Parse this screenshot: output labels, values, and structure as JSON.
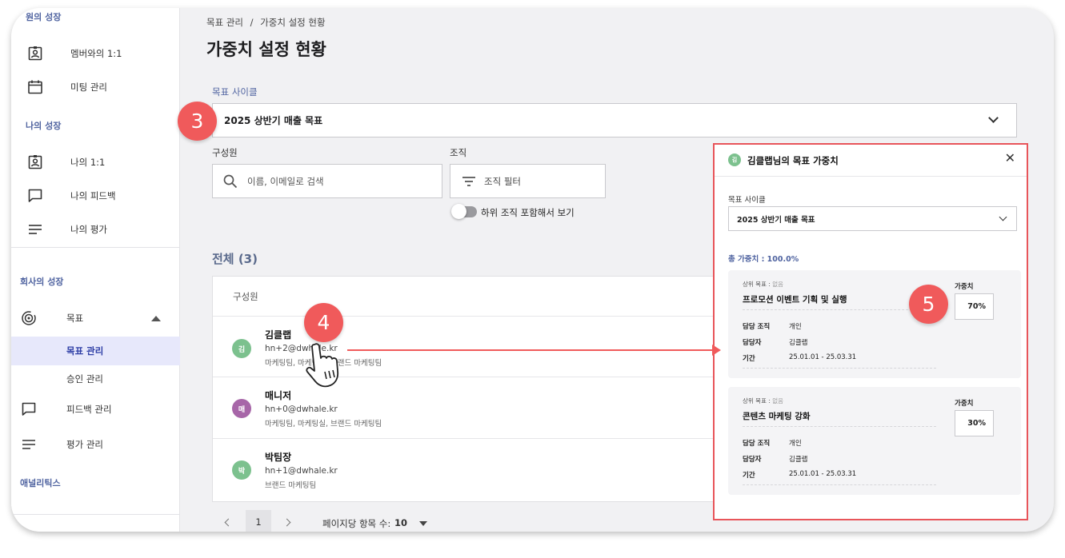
{
  "sidebar": {
    "team_growth_header": "원의 성장",
    "team_items": [
      {
        "label": "멤버와의 1:1",
        "icon": "portrait-badge-icon"
      },
      {
        "label": "미팅 관리",
        "icon": "calendar-icon"
      }
    ],
    "my_growth_header": "나의 성장",
    "my_items": [
      {
        "label": "나의 1:1",
        "icon": "portrait-badge-icon"
      },
      {
        "label": "나의 피드백",
        "icon": "chat-bubble-icon"
      },
      {
        "label": "나의 평가",
        "icon": "lines-icon"
      }
    ],
    "company_growth_header": "회사의 성장",
    "goal": {
      "label": "목표",
      "icon": "target-icon"
    },
    "goal_sub": [
      {
        "label": "목표 관리",
        "active": true
      },
      {
        "label": "승인 관리",
        "active": false
      }
    ],
    "feedback_mgmt": {
      "label": "피드백 관리",
      "icon": "chat-bubble-icon"
    },
    "review_mgmt": {
      "label": "평가 관리",
      "icon": "lines-icon"
    },
    "analytics_header": "애널리틱스"
  },
  "breadcrumb": {
    "parent": "목표 관리",
    "separator": "/",
    "current": "가중치 설정 현황"
  },
  "page_title": "가중치 설정 현황",
  "goal_cycle": {
    "label": "목표 사이클",
    "value": "2025 상반기 매출 목표"
  },
  "member_filter": {
    "label": "구성원",
    "placeholder": "이름, 이메일로 검색"
  },
  "org_filter": {
    "label": "조직",
    "value": "조직 필터"
  },
  "include_sub_org": {
    "label": "하위 조직 포함해서 보기",
    "enabled": false
  },
  "total_label": "전체 (3)",
  "table": {
    "column_header": "구성원",
    "rows": [
      {
        "initial": "김",
        "name": "김클랩",
        "email": "hn+2@dwhale.kr",
        "team": "마케팅팀, 마케팅실, 브랜드 마케팅팀",
        "color": "#7cc18e"
      },
      {
        "initial": "매",
        "name": "매니저",
        "email": "hn+0@dwhale.kr",
        "team": "마케팅팀, 마케팅실, 브랜드 마케팅팀",
        "color": "#a766a8"
      },
      {
        "initial": "박",
        "name": "박팀장",
        "email": "hn+1@dwhale.kr",
        "team": "브랜드 마케팅팀",
        "color": "#7cc18e"
      }
    ]
  },
  "pagination": {
    "current_page": "1",
    "per_page_label": "페이지당 항목 수:",
    "per_page_value": "10"
  },
  "panel": {
    "avatar_initial": "김",
    "title": "김클랩님의 목표 가중치",
    "cycle_label": "목표 사이클",
    "cycle_value": "2025 상반기 매출 목표",
    "total_weight": "총 가중치 : 100.0%",
    "cards": [
      {
        "parent_prefix": "상위 목표 : ",
        "parent_value": "없음",
        "title": "프로모션 이벤트 기획 및 실행",
        "weight_label": "가중치",
        "weight": "70%",
        "fields": [
          {
            "key": "담당 조직",
            "value": "개인"
          },
          {
            "key": "담당자",
            "value": "김클랩"
          },
          {
            "key": "기간",
            "value": "25.01.01 - 25.03.31"
          }
        ]
      },
      {
        "parent_prefix": "상위 목표 : ",
        "parent_value": "없음",
        "title": "콘텐츠 마케팅 강화",
        "weight_label": "가중치",
        "weight": "30%",
        "fields": [
          {
            "key": "담당 조직",
            "value": "개인"
          },
          {
            "key": "담당자",
            "value": "김클랩"
          },
          {
            "key": "기간",
            "value": "25.01.01 - 25.03.31"
          }
        ]
      }
    ]
  },
  "annotations": {
    "step_3": "3",
    "step_4": "4",
    "step_5": "5"
  },
  "colors": {
    "accent_red": "#f05a5b",
    "active_bg": "#e7e8fb",
    "label_blue": "#4f63a0"
  }
}
